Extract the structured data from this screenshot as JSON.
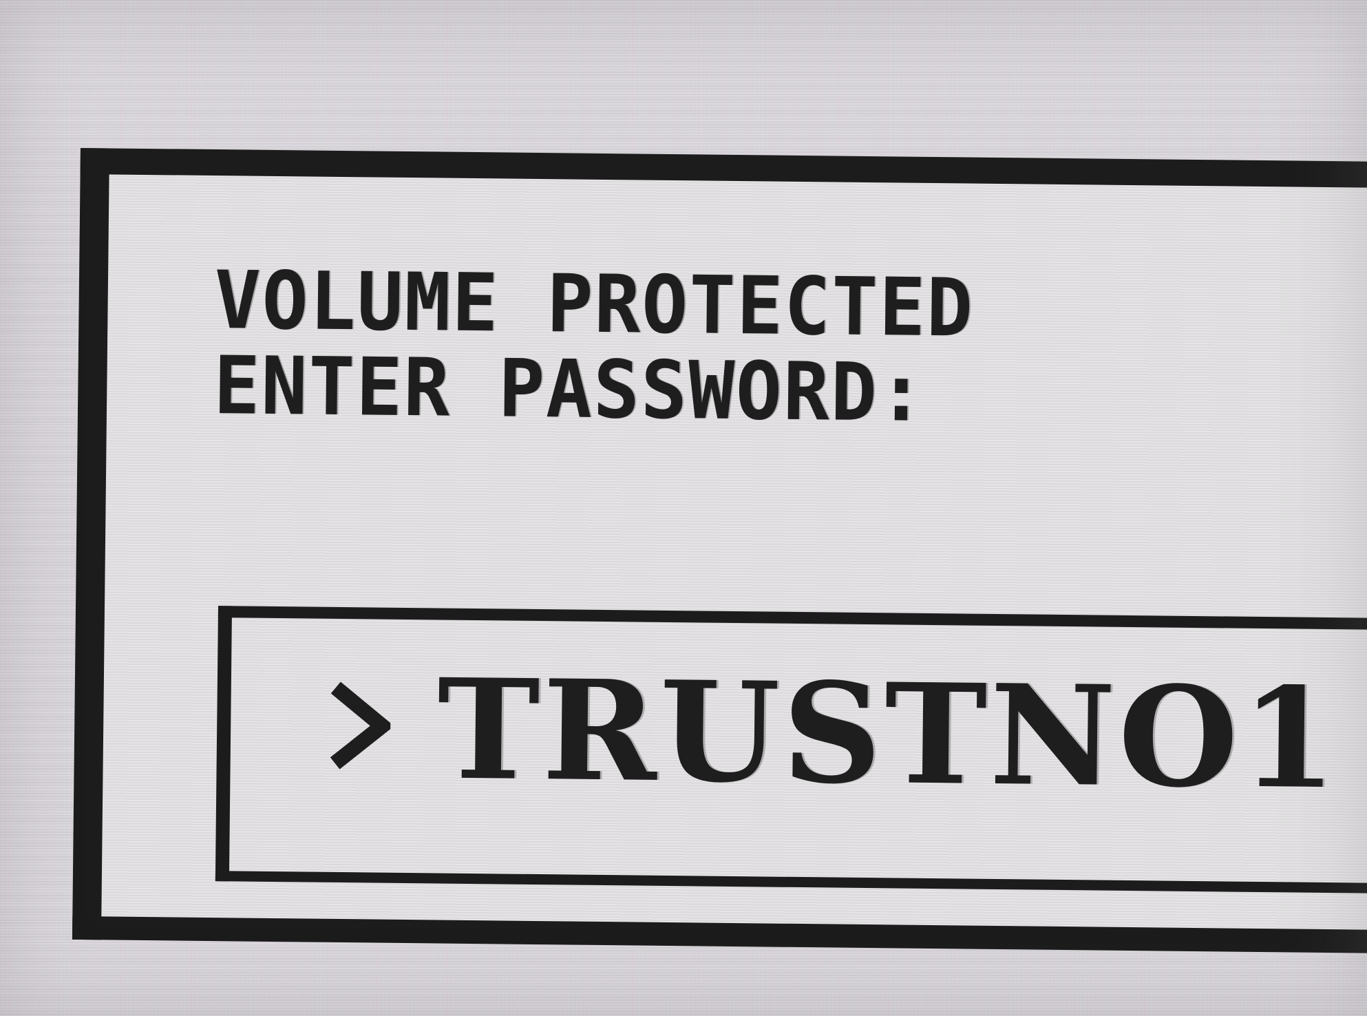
{
  "dialog": {
    "prompt_line_1": "VOLUME PROTECTED",
    "prompt_line_2": "ENTER PASSWORD:",
    "field": {
      "prompt_icon": "chevron-right-icon",
      "value": "TRUSTNO1"
    }
  },
  "colors": {
    "background": "#dcd8dc",
    "ink": "#1c1c1c"
  }
}
